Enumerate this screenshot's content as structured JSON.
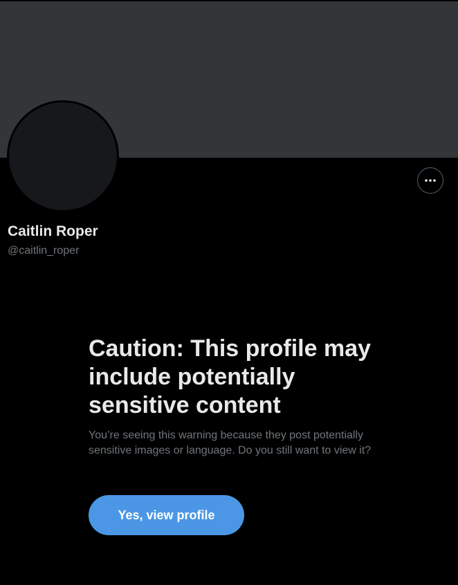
{
  "profile": {
    "display_name": "Caitlin Roper",
    "handle": "@caitlin_roper"
  },
  "header": {
    "more_icon": "more-horizontal-icon"
  },
  "warning": {
    "title": "Caution: This profile may include potentially sensitive content",
    "body": "You’re seeing this warning because they post potentially sensitive images or language. Do you still want to view it?",
    "button_label": "Yes, view profile"
  },
  "colors": {
    "background": "#000000",
    "banner": "#333639",
    "avatar": "#16181c",
    "primary_text": "#e7e9ea",
    "secondary_text": "#71767b",
    "accent": "#4b97e5"
  }
}
